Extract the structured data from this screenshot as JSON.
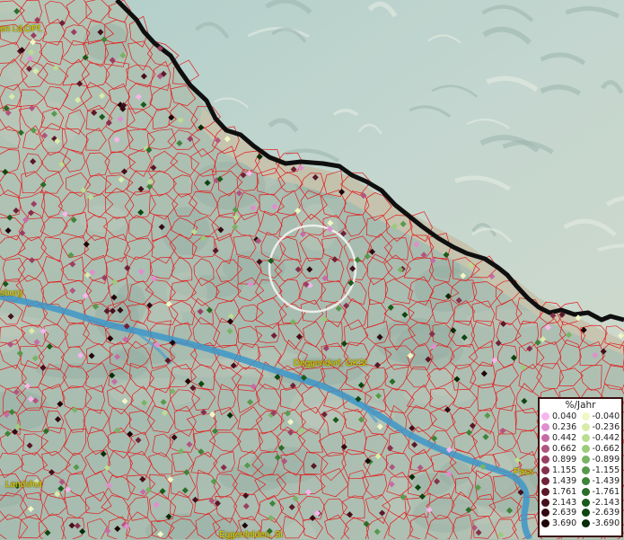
{
  "place_labels": [
    "en i.d.OPf.",
    "sburg",
    "Deggendorf, GKSt",
    "Landshut",
    "Pass",
    "Eggenfelden, St"
  ],
  "legend": {
    "title": "%/Jahr",
    "positive": {
      "labels": [
        "0.040",
        "0.236",
        "0.442",
        "0.662",
        "0.899",
        "1.155",
        "1.439",
        "1.761",
        "2.143",
        "2.639",
        "3.690"
      ],
      "colors": [
        "#f6b5ec",
        "#e08ecf",
        "#c66ca5",
        "#b0557f",
        "#9a3f62",
        "#86304b",
        "#702238",
        "#5a1828",
        "#45101c",
        "#320a12",
        "#1e0508"
      ]
    },
    "negative": {
      "labels": [
        "-0.040",
        "-0.236",
        "-0.442",
        "-0.662",
        "-0.899",
        "-1.155",
        "-1.439",
        "-1.761",
        "-2.143",
        "-2.639",
        "-3.690"
      ],
      "colors": [
        "#f1f7c4",
        "#d8ecaa",
        "#bcdc92",
        "#9ccb7a",
        "#79b364",
        "#58994c",
        "#3e8338",
        "#2a6d28",
        "#1a5a1a",
        "#0e460f",
        "#062d07"
      ]
    }
  },
  "colors": {
    "border_lines": "#e41a1c",
    "river": "#3d97c8",
    "frontier": "#111111",
    "label_text": "#e8d400"
  }
}
